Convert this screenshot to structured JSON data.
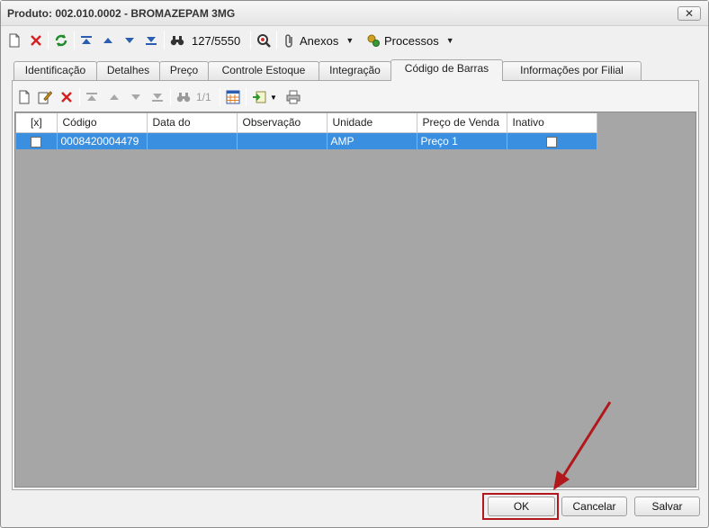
{
  "window": {
    "title": "Produto: 002.010.0002 - BROMAZEPAM 3MG",
    "close_label": "✕"
  },
  "toolbar": {
    "record_counter": "127/5550",
    "anexos_label": "Anexos",
    "processos_label": "Processos"
  },
  "tabs": [
    {
      "label": "Identificação"
    },
    {
      "label": "Detalhes"
    },
    {
      "label": "Preço"
    },
    {
      "label": "Controle Estoque"
    },
    {
      "label": "Integração"
    },
    {
      "label": "Código de Barras"
    },
    {
      "label": "Informações por Filial"
    }
  ],
  "subtoolbar": {
    "page_counter": "1/1"
  },
  "grid": {
    "columns": [
      "[x]",
      "Código",
      "Data do",
      "Observação",
      "Unidade",
      "Preço de Venda",
      "Inativo"
    ],
    "rows": [
      {
        "selected": false,
        "codigo": "0008420004479",
        "data_do": "",
        "observacao": "",
        "unidade": "AMP",
        "preco_venda": "Preço 1",
        "inativo": false
      }
    ]
  },
  "footer": {
    "ok_label": "OK",
    "cancel_label": "Cancelar",
    "save_label": "Salvar"
  },
  "colors": {
    "selection": "#3a8fe0",
    "grid_background": "#a6a6a6",
    "highlight": "#b0181c"
  }
}
